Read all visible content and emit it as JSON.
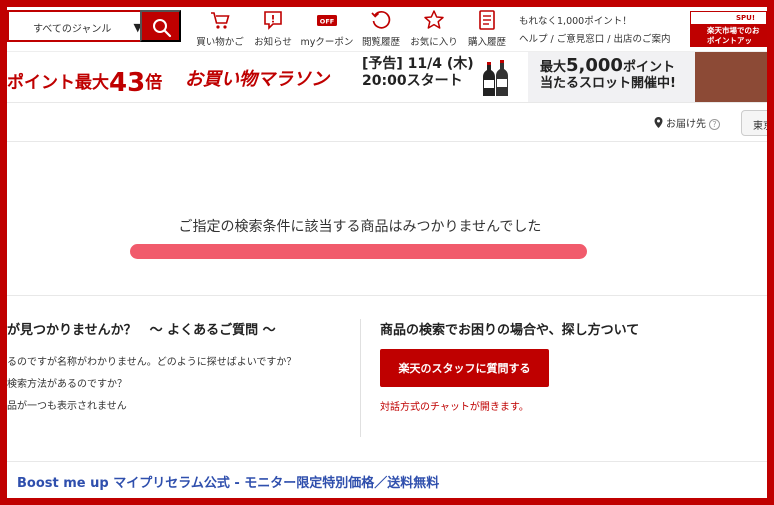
{
  "header": {
    "genre_select": "すべてのジャンル",
    "nav": [
      {
        "label": "買い物かご",
        "icon": "cart-icon"
      },
      {
        "label": "お知らせ",
        "icon": "notice-icon"
      },
      {
        "label": "myクーポン",
        "icon": "coupon-icon"
      },
      {
        "label": "閲覧履歴",
        "icon": "history-icon"
      },
      {
        "label": "お気に入り",
        "icon": "star-icon"
      },
      {
        "label": "購入履歴",
        "icon": "receipt-icon"
      }
    ],
    "coupon_badge": "OFF",
    "promo_text": "もれなく1,000ポイント！",
    "help_links": "ヘルプ / ご意見窓口 / 出店のご案内",
    "spu": {
      "tag": "SPU!",
      "line1": "楽天市場でのお",
      "line2": "ポイントアッ"
    }
  },
  "banner": {
    "points_prefix": "ポイント最大",
    "points_num": "43",
    "points_suffix": "倍",
    "marathon": "お買い物マラソン",
    "notice_line1": "[予告] 11/4 (木)",
    "notice_line2": "20:00スタート",
    "slot_line1_prefix": "最大",
    "slot_line1_num": "5,000",
    "slot_line1_suffix": "ポイント",
    "slot_line2": "当たるスロット開催中!"
  },
  "location": {
    "deliver_label": "お届け先",
    "help_mark": "?",
    "prefecture": "東京"
  },
  "not_found": {
    "message": "ご指定の検索条件に該当する商品はみつかりませんでした"
  },
  "faq": {
    "title": "が見つかりませんか？　〜 よくあるご質問 〜",
    "links": [
      "るのですが名称がわかりません。どのように探せばよいですか？",
      "検索方法があるのですか？",
      "品が一つも表示されません"
    ]
  },
  "search_help": {
    "title": "商品の検索でお困りの場合や、探し方ついて",
    "button": "楽天のスタッフに質問する",
    "note": "対話方式のチャットが開きます。"
  },
  "promo": {
    "link": "Boost me up マイプリセラム公式 - モニター限定特別価格／送料無料"
  },
  "colors": {
    "brand_red": "#bf0000",
    "progress_pink": "#f15b6c",
    "link_blue": "#2f4fad",
    "banner_brown": "#8c4a36"
  }
}
